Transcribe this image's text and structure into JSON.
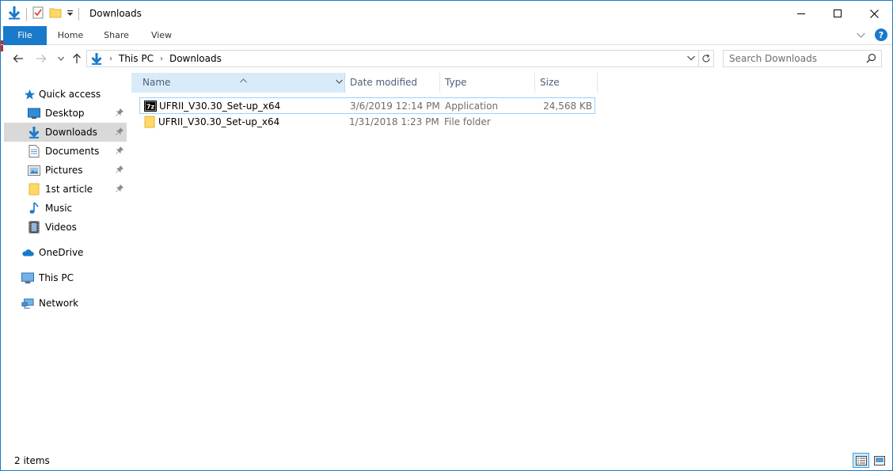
{
  "window": {
    "title": "Downloads",
    "accent_color": "#1979ca"
  },
  "ribbon": {
    "tabs": [
      {
        "label": "File",
        "active": true
      },
      {
        "label": "Home"
      },
      {
        "label": "Share"
      },
      {
        "label": "View"
      }
    ]
  },
  "address": {
    "breadcrumbs": [
      "This PC",
      "Downloads"
    ]
  },
  "search": {
    "placeholder": "Search Downloads"
  },
  "nav": {
    "items": [
      {
        "label": "Quick access",
        "icon": "star-icon"
      },
      {
        "label": "Desktop",
        "icon": "desktop-icon",
        "pinned": true
      },
      {
        "label": "Downloads",
        "icon": "download-arrow-icon",
        "pinned": true,
        "selected": true
      },
      {
        "label": "Documents",
        "icon": "documents-icon",
        "pinned": true
      },
      {
        "label": "Pictures",
        "icon": "pictures-icon",
        "pinned": true
      },
      {
        "label": "1st article",
        "icon": "folder-icon",
        "pinned": true
      },
      {
        "label": "Music",
        "icon": "music-note-icon"
      },
      {
        "label": "Videos",
        "icon": "film-icon"
      },
      {
        "label": "OneDrive",
        "icon": "cloud-icon"
      },
      {
        "label": "This PC",
        "icon": "computer-icon"
      },
      {
        "label": "Network",
        "icon": "network-icon"
      }
    ]
  },
  "columns": {
    "name": "Name",
    "date": "Date modified",
    "type": "Type",
    "size": "Size"
  },
  "files": [
    {
      "name": "UFRII_V30.30_Set-up_x64",
      "date": "3/6/2019 12:14 PM",
      "type": "Application",
      "size": "24,568 KB",
      "icon": "7zip-icon",
      "focused": true
    },
    {
      "name": "UFRII_V30.30_Set-up_x64",
      "date": "1/31/2018 1:23 PM",
      "type": "File folder",
      "size": "",
      "icon": "folder-icon"
    }
  ],
  "status": {
    "item_count": "2 items"
  }
}
